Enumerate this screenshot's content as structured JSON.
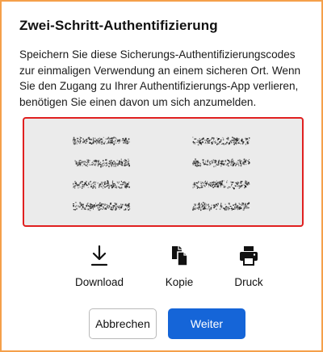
{
  "dialog": {
    "title": "Zwei-Schritt-Authentifizierung",
    "description": "Speichern Sie diese Sicherungs-Authentifizierungscodes zur einmaligen Verwendung an einem sicheren Ort. Wenn Sie den Zugang zu Ihrer Authentifizierungs-App verlieren, benötigen Sie einen davon um sich anzumelden.",
    "codes_state": "obscured",
    "code_count": 8
  },
  "actions": {
    "download_label": "Download",
    "copy_label": "Kopie",
    "print_label": "Druck"
  },
  "buttons": {
    "cancel_label": "Abbrechen",
    "next_label": "Weiter"
  },
  "colors": {
    "dialog_border": "#f5a04a",
    "codes_border": "#e02020",
    "codes_background": "#ebebeb",
    "primary": "#1565d8"
  }
}
